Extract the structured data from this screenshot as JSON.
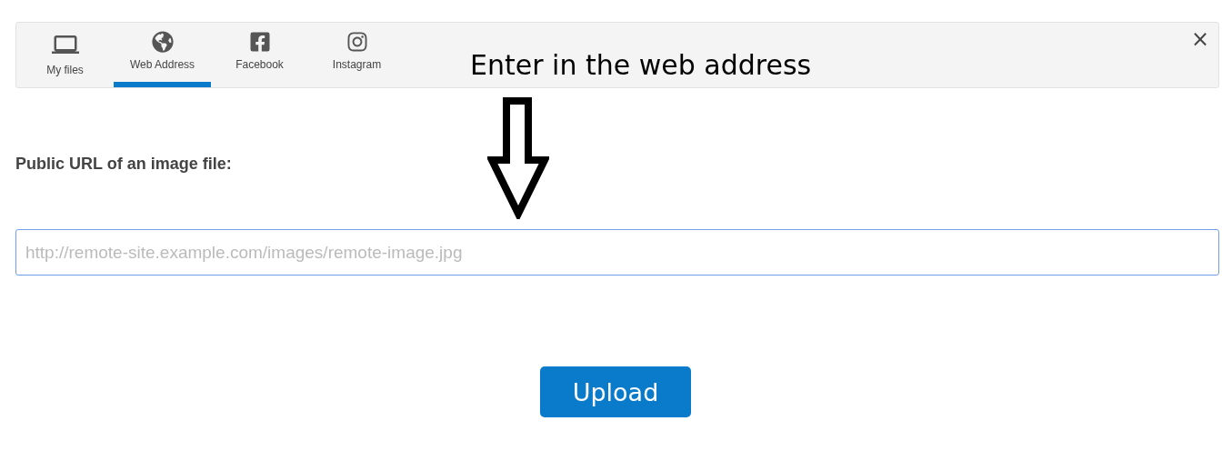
{
  "tabs": [
    {
      "label": "My files",
      "kind": "files",
      "selected": false
    },
    {
      "label": "Web Address",
      "kind": "web",
      "selected": true
    },
    {
      "label": "Facebook",
      "kind": "facebook",
      "selected": false
    },
    {
      "label": "Instagram",
      "kind": "instagram",
      "selected": false
    }
  ],
  "close": "×",
  "annotation": "Enter in the web address",
  "url_label": "Public URL of an image file:",
  "url_field": {
    "placeholder": "http://remote-site.example.com/images/remote-image.jpg"
  },
  "upload_button": "Upload"
}
